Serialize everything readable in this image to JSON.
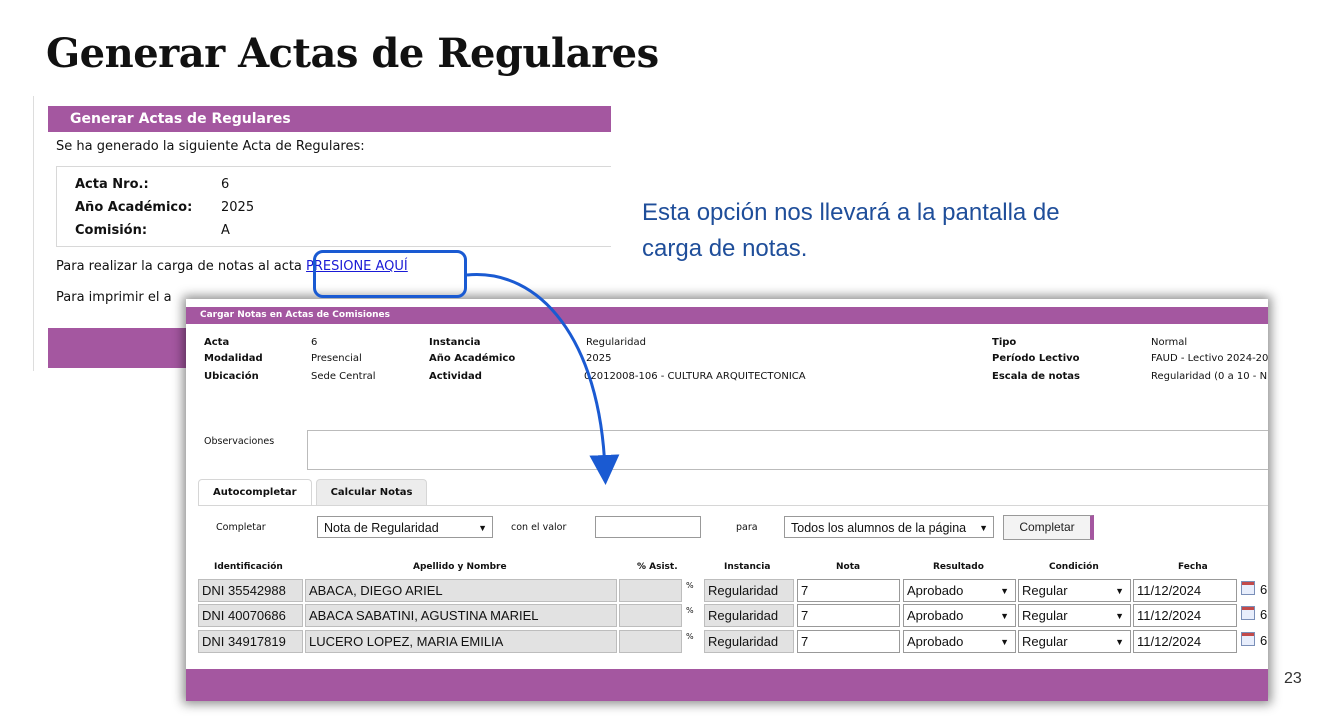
{
  "slide": {
    "title": "Generar Actas de Regulares",
    "caption": "Esta opción nos llevará a la pantalla de carga de notas.",
    "page_number": "23"
  },
  "colors": {
    "header_purple": "#a457a0",
    "highlight_blue": "#1a5ad2",
    "caption_blue": "#1f4e9a"
  },
  "generar": {
    "header": "Generar Actas de Regulares",
    "message": "Se ha generado la siguiente Acta de Regulares:",
    "fields": [
      {
        "label": "Acta Nro.:",
        "value": "6"
      },
      {
        "label": "Año Académico:",
        "value": "2025"
      },
      {
        "label": "Comisión:",
        "value": "A"
      }
    ],
    "carga_prefix": "Para realizar la carga de notas al acta",
    "carga_link": "PRESIONE AQUÍ",
    "imprimir_prefix": "Para imprimir el a"
  },
  "cargar": {
    "header": "Cargar Notas en Actas de Comisiones",
    "info": {
      "acta_label": "Acta",
      "acta_value": "6",
      "modalidad_label": "Modalidad",
      "modalidad_value": "Presencial",
      "ubicacion_label": "Ubicación",
      "ubicacion_value": "Sede Central",
      "instancia_label": "Instancia",
      "instancia_value": "Regularidad",
      "anio_label": "Año Académico",
      "anio_value": "2025",
      "actividad_label": "Actividad",
      "actividad_value": "02012008-106 - CULTURA ARQUITECTONICA",
      "tipo_label": "Tipo",
      "tipo_value": "Normal",
      "periodo_label": "Período Lectivo",
      "periodo_value": "FAUD - Lectivo 2024-20",
      "escala_label": "Escala de notas",
      "escala_value": "Regularidad (0 a 10 - N"
    },
    "observaciones_label": "Observaciones",
    "tabs": [
      "Autocompletar",
      "Calcular Notas"
    ],
    "autocompletar": {
      "completar_label": "Completar",
      "campo_value": "Nota de Regularidad",
      "con_valor_label": "con el valor",
      "para_label": "para",
      "para_value": "Todos los alumnos de la página",
      "button_label": "Completar"
    },
    "columns": [
      "Identificación",
      "Apellido y Nombre",
      "% Asist.",
      "Instancia",
      "Nota",
      "Resultado",
      "Condición",
      "Fecha"
    ],
    "pct_symbol": "%",
    "rows": [
      {
        "id": "DNI 35542988",
        "name": "ABACA, DIEGO ARIEL",
        "instancia": "Regularidad",
        "nota": "7",
        "resultado": "Aprobado",
        "condicion": "Regular",
        "fecha": "11/12/2024",
        "extra": "6"
      },
      {
        "id": "DNI 40070686",
        "name": "ABACA SABATINI, AGUSTINA MARIEL",
        "instancia": "Regularidad",
        "nota": "7",
        "resultado": "Aprobado",
        "condicion": "Regular",
        "fecha": "11/12/2024",
        "extra": "6"
      },
      {
        "id": "DNI 34917819",
        "name": "LUCERO LOPEZ, MARIA EMILIA",
        "instancia": "Regularidad",
        "nota": "7",
        "resultado": "Aprobado",
        "condicion": "Regular",
        "fecha": "11/12/2024",
        "extra": "6"
      }
    ]
  }
}
